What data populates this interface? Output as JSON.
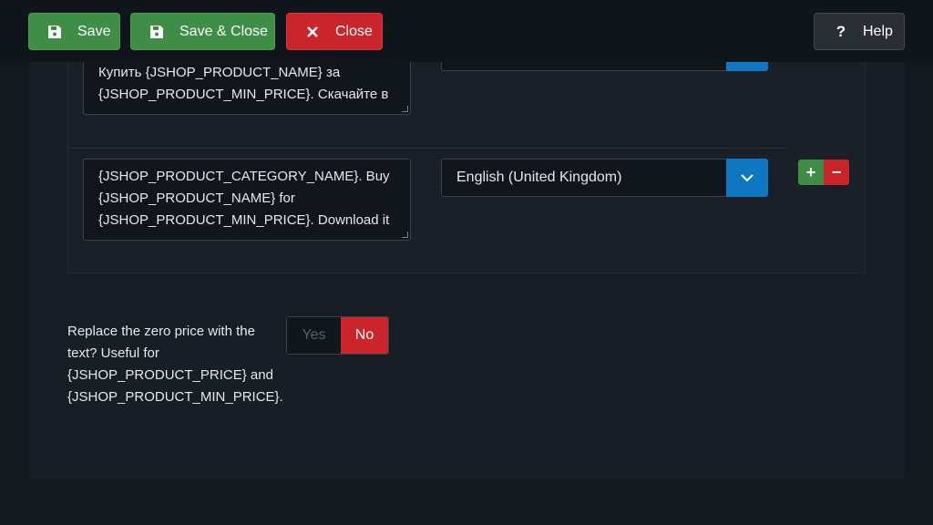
{
  "toolbar": {
    "save_label": "Save",
    "save_close_label": "Save & Close",
    "close_label": "Close",
    "help_label": "Help"
  },
  "rows": [
    {
      "lines": [
        "Купить {JSHOP_PRODUCT_NAME} за",
        "{JSHOP_PRODUCT_MIN_PRICE}. Скачайте в"
      ]
    },
    {
      "lines": [
        "{JSHOP_PRODUCT_CATEGORY_NAME}. Buy",
        "{JSHOP_PRODUCT_NAME} for",
        "{JSHOP_PRODUCT_MIN_PRICE}. Download it"
      ],
      "language": "English (United Kingdom)"
    }
  ],
  "row_controls": {
    "add": "+",
    "remove": "−"
  },
  "zero_price": {
    "label_lines": [
      "Replace the zero price with the",
      "text? Useful for",
      "{JSHOP_PRODUCT_PRICE} and",
      "{JSHOP_PRODUCT_MIN_PRICE}."
    ],
    "yes": "Yes",
    "no": "No",
    "selected": "No"
  },
  "colors": {
    "green": "#3e8e47",
    "red": "#c9252a",
    "blue": "#1077c2",
    "dark": "#141920"
  },
  "icons": [
    "save-icon",
    "close-icon",
    "help-icon",
    "chevron-down-icon"
  ]
}
